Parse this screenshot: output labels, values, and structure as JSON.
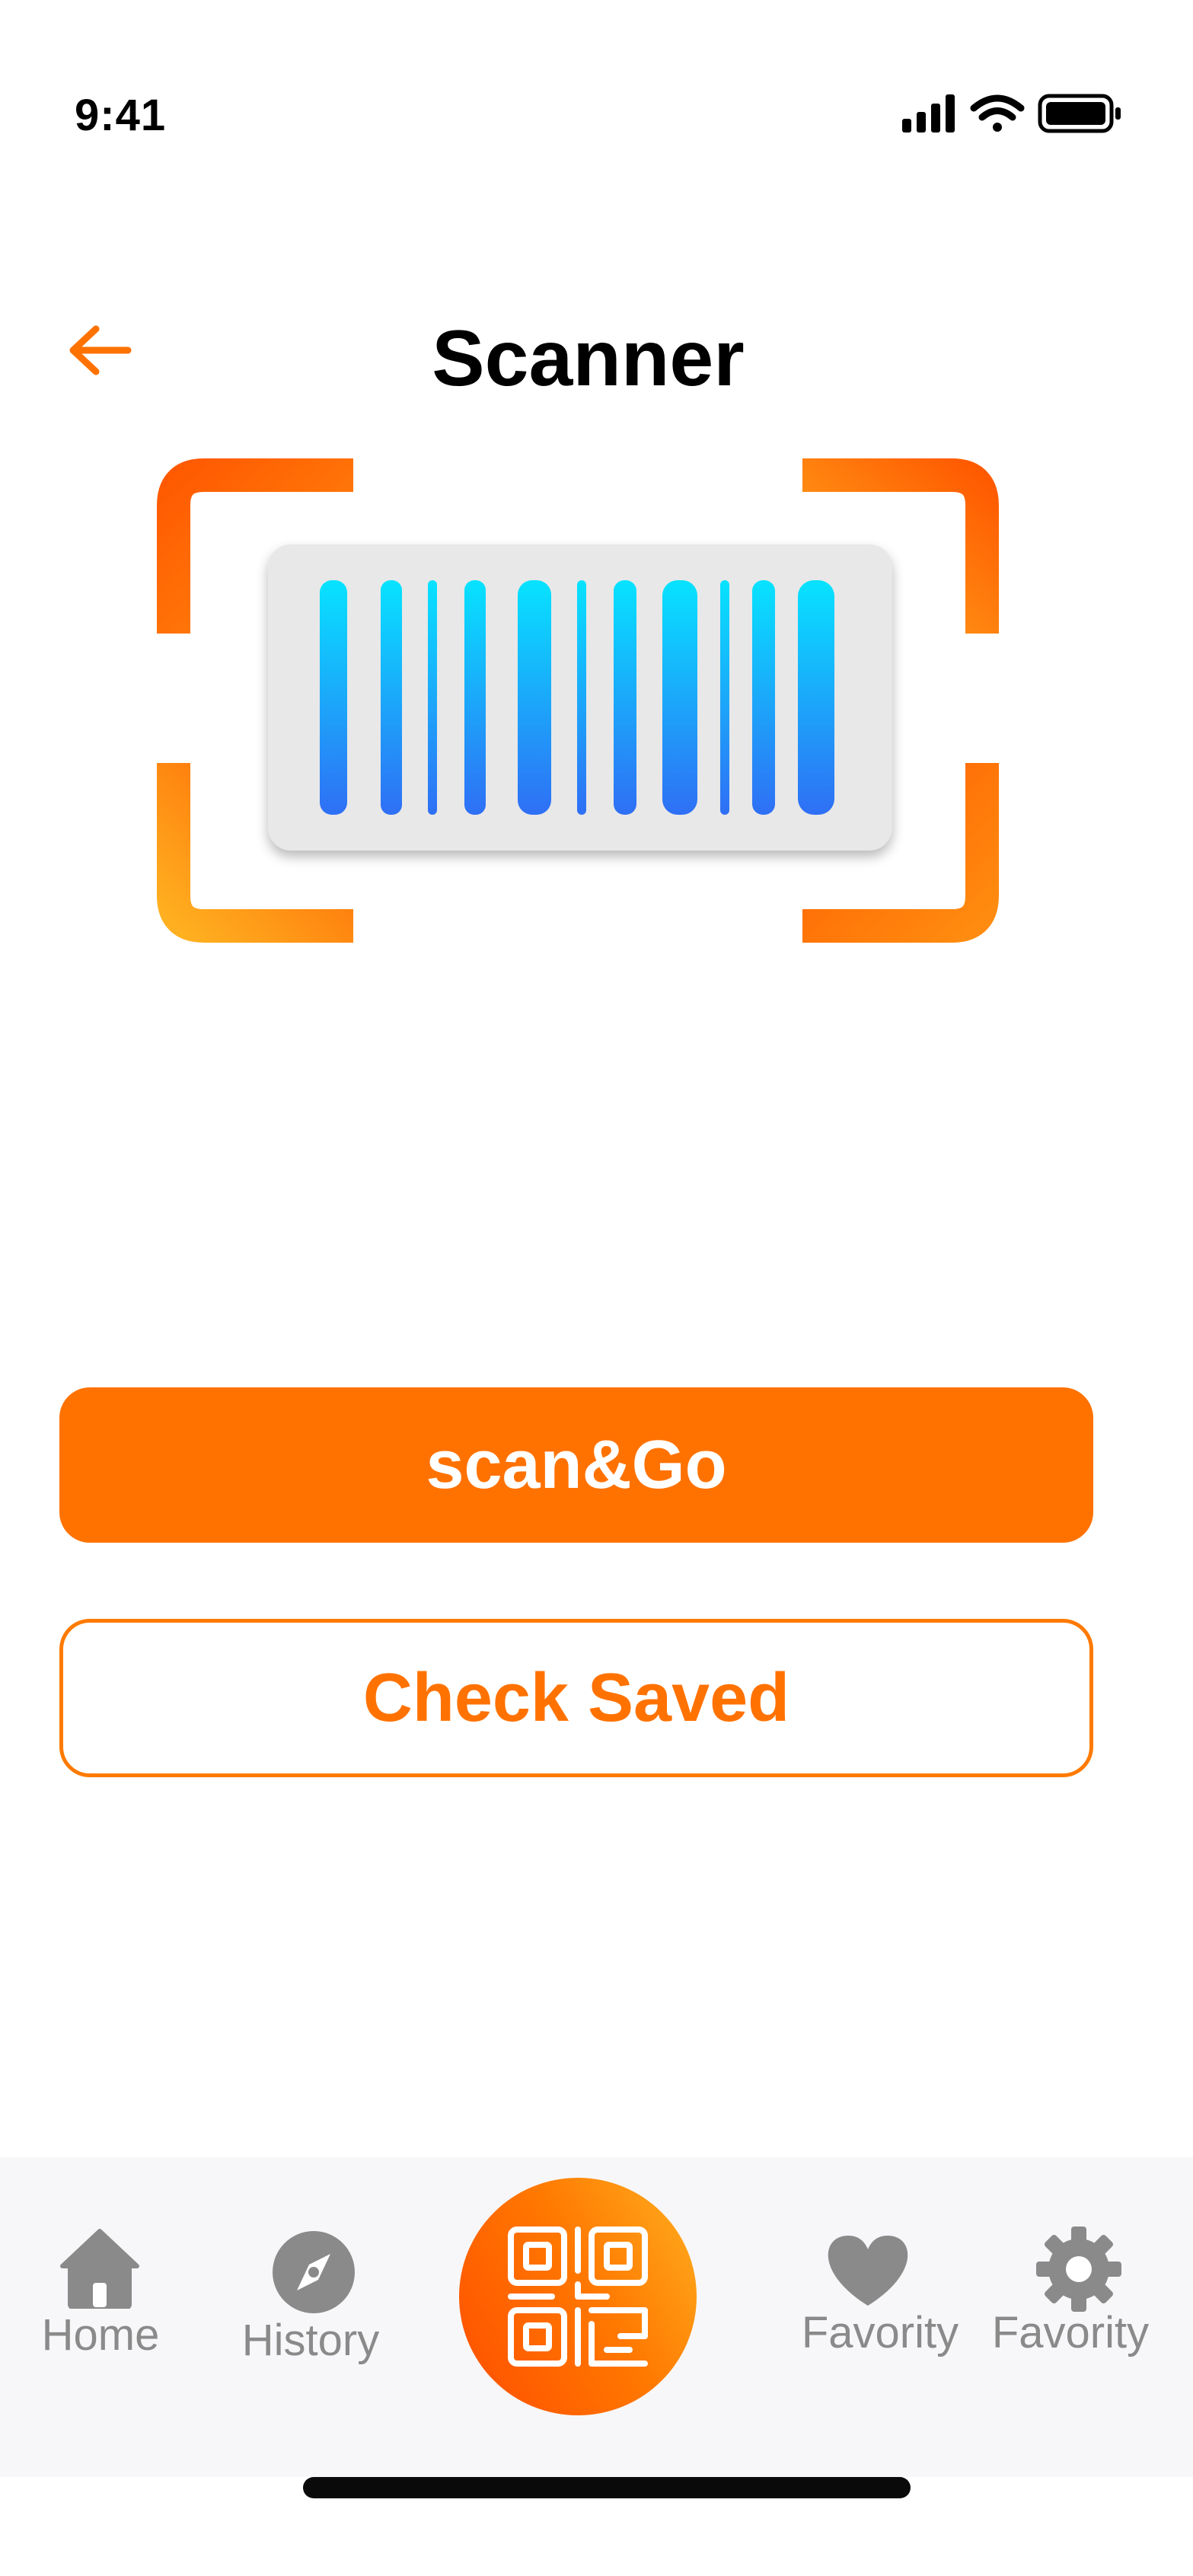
{
  "status_bar": {
    "time": "9:41",
    "icons": [
      "signal-icon",
      "wifi-icon",
      "battery-icon"
    ]
  },
  "header": {
    "back_icon": "arrow-left-icon",
    "title": "Scanner"
  },
  "scanner": {
    "frame_gradient": [
      "#ff5a00",
      "#ffb020"
    ],
    "barcode_gradient": [
      "#07e3ff",
      "#2f6ff5"
    ]
  },
  "buttons": {
    "primary_label": "scan&Go",
    "secondary_label": "Check Saved"
  },
  "tabbar": {
    "items": [
      {
        "label": "Home",
        "icon": "home-icon"
      },
      {
        "label": "History",
        "icon": "compass-icon"
      },
      {
        "label": "",
        "icon": "qr-code-icon"
      },
      {
        "label": "Favority",
        "icon": "heart-icon"
      },
      {
        "label": "Favority",
        "icon": "gear-icon"
      }
    ]
  },
  "colors": {
    "accent": "#ff7200",
    "tab_inactive": "#8a8a8a",
    "background": "#ffffff"
  }
}
